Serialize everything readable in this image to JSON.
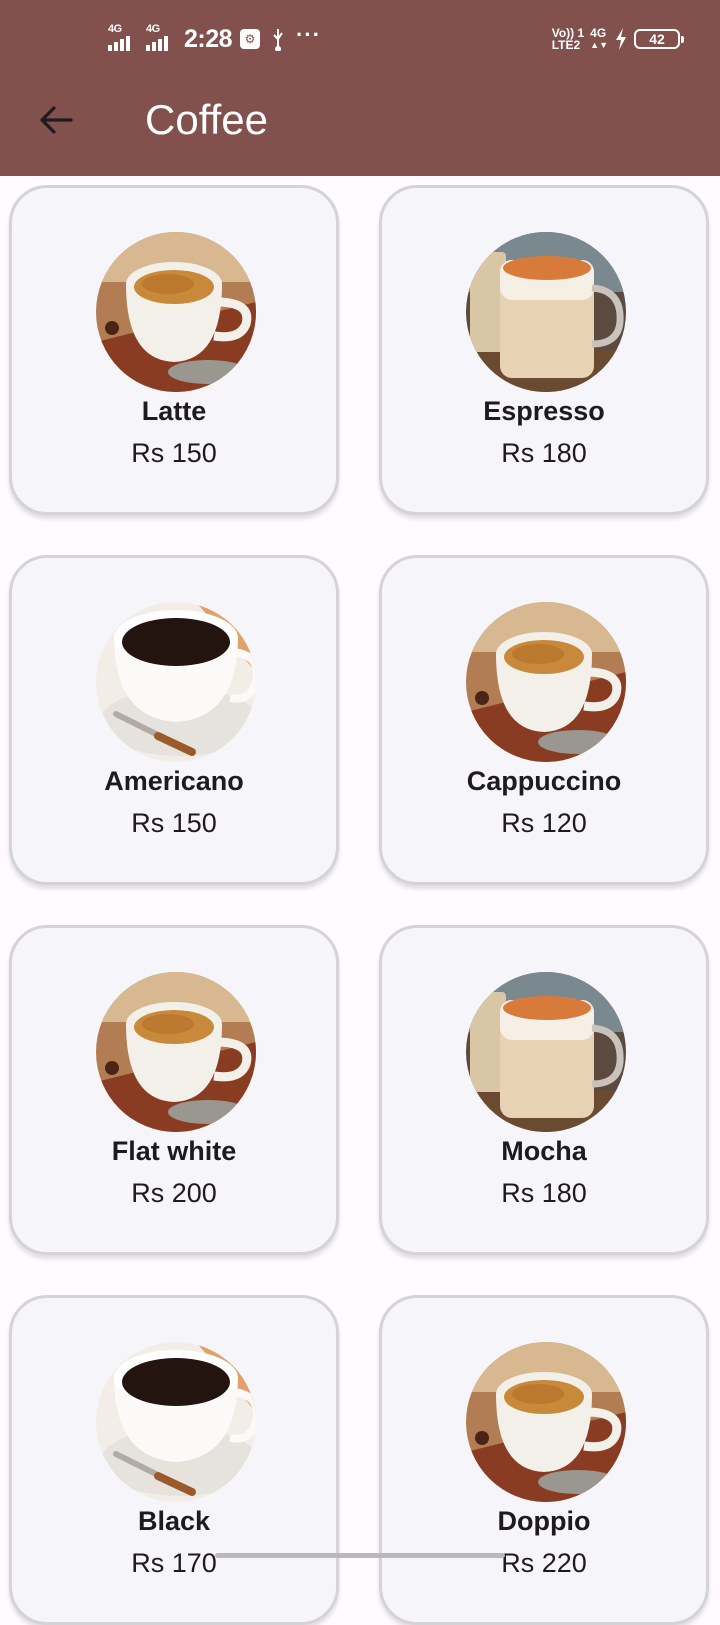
{
  "status_bar": {
    "sim1_network": "4G",
    "sim2_network": "4G",
    "time": "2:28",
    "volte_line1": "Vo)) 1",
    "volte_line2": "LTE2",
    "data_network": "4G",
    "battery_level": "42",
    "icons": [
      "signal-icon",
      "signal-icon",
      "app-notification-icon",
      "usb-icon",
      "more-dots-icon",
      "volte-icon",
      "data-icon",
      "charging-icon",
      "battery-icon"
    ]
  },
  "app_bar": {
    "title": "Coffee",
    "back_icon": "arrow-left-icon",
    "background": "#82514e"
  },
  "items": [
    {
      "name": "Latte",
      "price": "Rs 150",
      "image": "espresso-cup"
    },
    {
      "name": "Espresso",
      "price": "Rs 180",
      "image": "glass-latte"
    },
    {
      "name": "Americano",
      "price": "Rs 150",
      "image": "black-coffee"
    },
    {
      "name": "Cappuccino",
      "price": "Rs 120",
      "image": "espresso-cup"
    },
    {
      "name": "Flat white",
      "price": "Rs 200",
      "image": "espresso-cup"
    },
    {
      "name": "Mocha",
      "price": "Rs 180",
      "image": "glass-latte"
    },
    {
      "name": "Black",
      "price": "Rs 170",
      "image": "black-coffee"
    },
    {
      "name": "Doppio",
      "price": "Rs 220",
      "image": "espresso-cup"
    }
  ]
}
